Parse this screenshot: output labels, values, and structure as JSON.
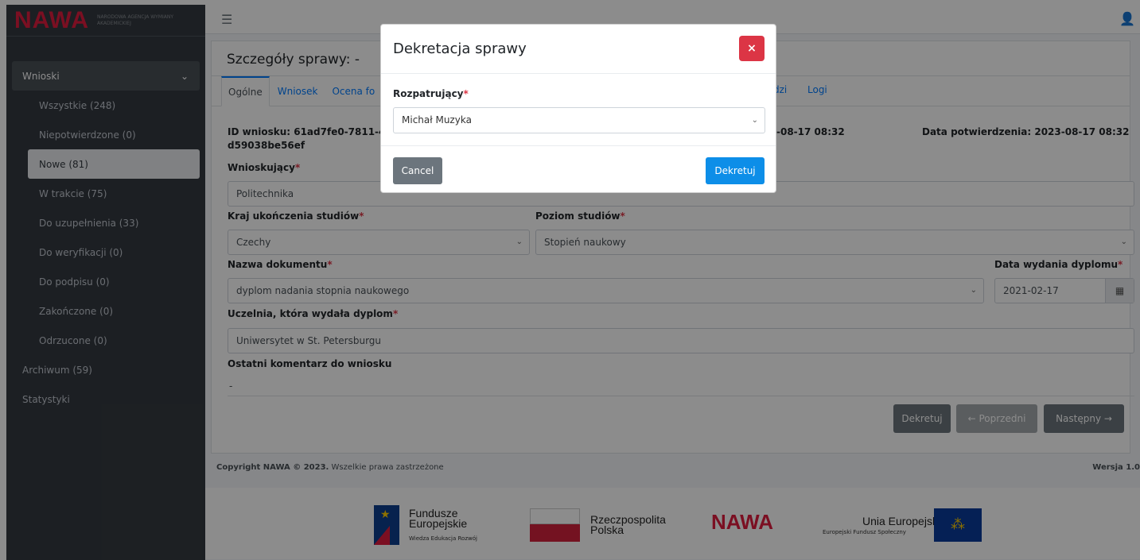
{
  "brand": {
    "logo": "NAWA",
    "subtitle": "Narodowa Agencja Wymiany Akademickiej"
  },
  "sidebar": {
    "group": "Wnioski",
    "items": [
      {
        "label": "Wszystkie (248)"
      },
      {
        "label": "Niepotwierdzone (0)"
      },
      {
        "label": "Nowe (81)"
      },
      {
        "label": "W trakcie (75)"
      },
      {
        "label": "Do uzupełnienia (33)"
      },
      {
        "label": "Do weryfikacji (0)"
      },
      {
        "label": "Do podpisu (0)"
      },
      {
        "label": "Zakończone (0)"
      },
      {
        "label": "Odrzucone (0)"
      }
    ],
    "archive": "Archiwum (59)",
    "stats": "Statystyki"
  },
  "page": {
    "title": "Szczegóły sprawy: -",
    "tabs": [
      "Ogólne",
      "Wniosek",
      "Ocena fo"
    ],
    "tab_dzi": "dzi",
    "tab_logi": "Logi",
    "id_label": "ID wniosku: 61ad7fe0-7811-4048",
    "id_label_2": "d59038be56ef",
    "date_partial": "-08-17 08:32",
    "confirm_date": "Data potwierdzenia: 2023-08-17 08:32",
    "applicant_label": "Wnioskujący",
    "applicant_value": "Politechnika",
    "country_label": "Kraj ukończenia studiów",
    "country_value": "Czechy",
    "level_label": "Poziom studiów",
    "level_value": "Stopień naukowy",
    "doc_label": "Nazwa dokumentu",
    "doc_value": "dyplom nadania stopnia naukowego",
    "issue_date_label": "Data wydania dyplomu",
    "issue_date_value": "2021-02-17",
    "uni_label": "Uczelnia, która wydała dyplom",
    "uni_value": "Uniwersytet w St. Petersburgu",
    "comment_label": "Ostatni komentarz do wniosku",
    "comment_value": "-",
    "btn_dekretuj": "Dekretuj",
    "btn_prev": "← Poprzedni",
    "btn_next": "Następny →",
    "required_mark": "*"
  },
  "footer": {
    "copyright_bold": "Copyright NAWA © 2023.",
    "copyright_rest": "Wszelkie prawa zastrzeżone",
    "version": "Wersja 1.0"
  },
  "logos": {
    "fe_title": "Fundusze Europejskie",
    "fe_sub": "Wiedza Edukacja Rozwój",
    "rp": "Rzeczpospolita Polska",
    "nawa": "NAWA",
    "ue_title": "Unia Europejska",
    "ue_sub": "Europejski Fundusz Społeczny"
  },
  "modal": {
    "title": "Dekretacja sprawy",
    "close": "×",
    "label": "Rozpatrujący",
    "selected": "Michał Muzyka",
    "cancel": "Cancel",
    "confirm": "Dekretuj"
  },
  "colors": {
    "accent": "#007bff",
    "danger": "#dc3545",
    "sidebar": "#343a40",
    "brand": "#e11d3f"
  }
}
